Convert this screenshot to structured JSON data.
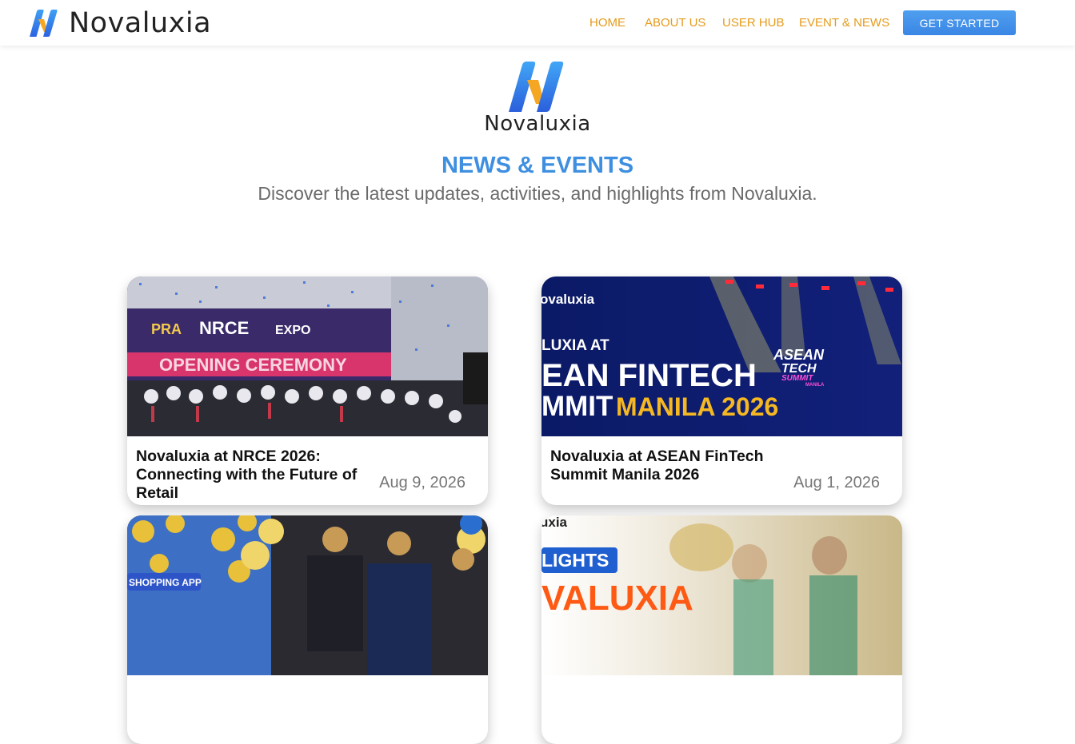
{
  "header": {
    "brand": "Novaluxia",
    "nav": [
      "HOME",
      "ABOUT US",
      "USER HUB",
      "EVENT & NEWS"
    ],
    "cta_label": "GET STARTED"
  },
  "hero": {
    "wordmark": "Novaluxia",
    "title": "NEWS & EVENTS",
    "subtitle": "Discover the latest updates, activities, and highlights from Novaluxia."
  },
  "cards": [
    {
      "title": "Novaluxia at NRCE 2026: Connecting with the Future of Retail",
      "date": "Aug 9, 2026",
      "image_text": [
        "PRA",
        "NRCE",
        "EXPO",
        "OPENING CEREMONY"
      ]
    },
    {
      "title": "Novaluxia at ASEAN FinTech Summit Manila 2026",
      "date": "Aug 1, 2026",
      "image_text": [
        "ovaluxia",
        "LUXIA AT",
        "EAN FINTECH",
        "MMIT",
        "MANILA 2026",
        "ASEAN",
        "TECH",
        "SUMMIT",
        "MANILA"
      ]
    },
    {
      "title": "",
      "date": "",
      "image_text": [
        "SHOPPING APP"
      ]
    },
    {
      "title": "",
      "date": "",
      "image_text": [
        "uxia",
        "LIGHTS",
        "VALUXIA"
      ]
    }
  ],
  "colors": {
    "accent_blue": "#3e8fe0",
    "nav_orange": "#e59b1c",
    "logo_blue": "#2f6fe0",
    "logo_orange": "#f5a623"
  }
}
